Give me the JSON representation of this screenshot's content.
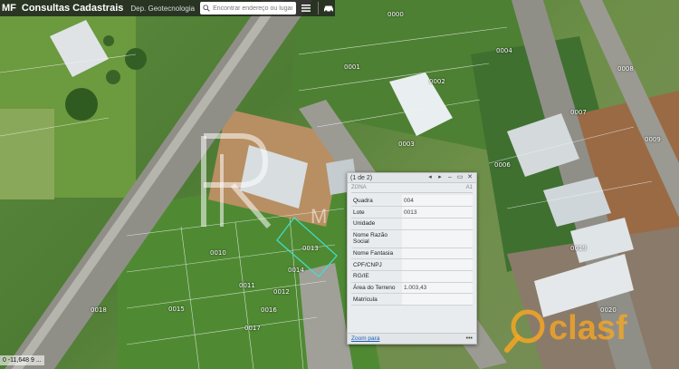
{
  "topbar": {
    "logo": "MF",
    "title": "Consultas Cadastrais",
    "dept": "Dep. Geotecnologia",
    "search_placeholder": "Encontrar endereço ou lugar",
    "buttons": [
      "menu",
      "car"
    ]
  },
  "lots": [
    "0000",
    "0001",
    "0002",
    "0003",
    "0004",
    "0006",
    "0007",
    "0008",
    "0009",
    "0010",
    "0011",
    "0012",
    "0013",
    "0014",
    "0015",
    "0016",
    "0017",
    "0018",
    "0019",
    "0020"
  ],
  "popup": {
    "title": "(1 de 2)",
    "subhead_left": "ZONA",
    "subhead_right": "A1",
    "fields": [
      {
        "label": "Quadra",
        "value": "004"
      },
      {
        "label": "Lote",
        "value": "0013"
      },
      {
        "label": "Unidade",
        "value": ""
      },
      {
        "label": "Nome Razão Social",
        "value": ""
      },
      {
        "label": "Nome Fantasia",
        "value": ""
      },
      {
        "label": "CPF/CNPJ",
        "value": ""
      },
      {
        "label": "RG/IE",
        "value": ""
      },
      {
        "label": "Área do Terreno",
        "value": "1.003,43"
      },
      {
        "label": "Matrícula",
        "value": ""
      }
    ],
    "zoom_link": "Zoom para",
    "more": "•••"
  },
  "scale_text": "0 -11,648 9 ...",
  "watermark": {
    "monogram": "R",
    "text": "M"
  },
  "badge": {
    "text": "clasf"
  },
  "colors": {
    "topbar": "#1e1e1e",
    "highlight": "#3fe0d0",
    "link": "#1a5fb4",
    "badge": "#f5a623"
  }
}
